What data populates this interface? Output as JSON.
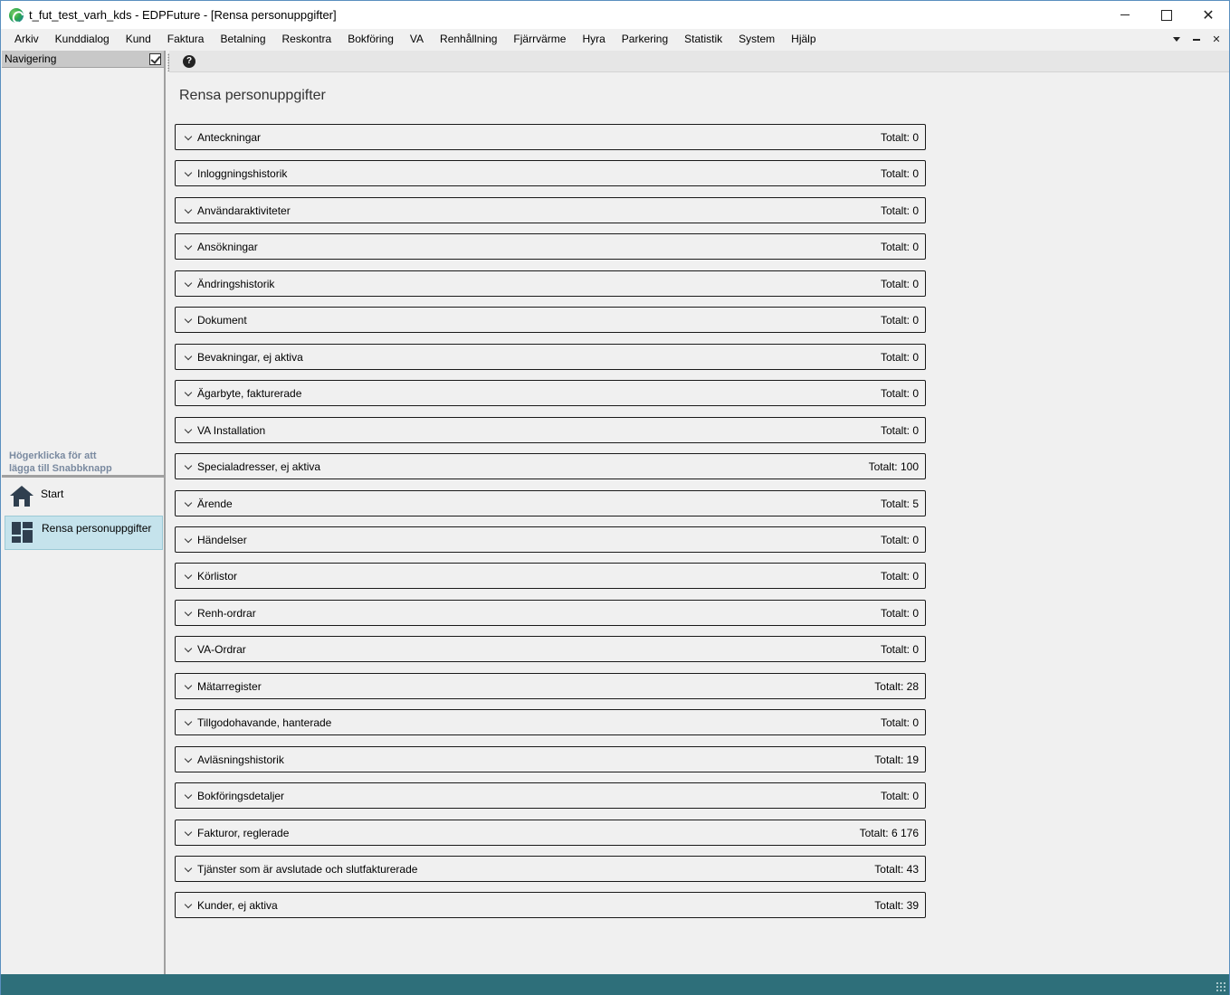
{
  "window": {
    "title": "t_fut_test_varh_kds - EDPFuture - [Rensa personuppgifter]",
    "close_glyph": "✕"
  },
  "menu": [
    "Arkiv",
    "Kunddialog",
    "Kund",
    "Faktura",
    "Betalning",
    "Reskontra",
    "Bokföring",
    "VA",
    "Renhållning",
    "Fjärrvärme",
    "Hyra",
    "Parkering",
    "Statistik",
    "System",
    "Hjälp"
  ],
  "menu_close_glyph": "✕",
  "navigation": {
    "title": "Navigering",
    "hint_line1": "Högerklicka för att",
    "hint_line2": "lägga till Snabbknapp",
    "shortcuts": [
      {
        "label": "Start",
        "icon": "home-icon",
        "active": false
      },
      {
        "label": "Rensa personuppgifter",
        "icon": "dashboard-icon",
        "active": true
      }
    ]
  },
  "toolbar": {
    "help_glyph": "?"
  },
  "page": {
    "title": "Rensa personuppgifter",
    "sections": [
      {
        "label": "Anteckningar",
        "total": "Totalt: 0"
      },
      {
        "label": "Inloggningshistorik",
        "total": "Totalt: 0"
      },
      {
        "label": "Användaraktiviteter",
        "total": "Totalt: 0"
      },
      {
        "label": "Ansökningar",
        "total": "Totalt: 0"
      },
      {
        "label": "Ändringshistorik",
        "total": "Totalt: 0"
      },
      {
        "label": "Dokument",
        "total": "Totalt: 0"
      },
      {
        "label": "Bevakningar, ej aktiva",
        "total": "Totalt: 0"
      },
      {
        "label": "Ägarbyte, fakturerade",
        "total": "Totalt: 0"
      },
      {
        "label": "VA Installation",
        "total": "Totalt: 0"
      },
      {
        "label": "Specialadresser, ej aktiva",
        "total": "Totalt: 100"
      },
      {
        "label": "Ärende",
        "total": "Totalt: 5"
      },
      {
        "label": "Händelser",
        "total": "Totalt: 0"
      },
      {
        "label": "Körlistor",
        "total": "Totalt: 0"
      },
      {
        "label": "Renh-ordrar",
        "total": "Totalt: 0"
      },
      {
        "label": "VA-Ordrar",
        "total": "Totalt: 0"
      },
      {
        "label": "Mätarregister",
        "total": "Totalt: 28"
      },
      {
        "label": "Tillgodohavande, hanterade",
        "total": "Totalt: 0"
      },
      {
        "label": "Avläsningshistorik",
        "total": "Totalt: 19"
      },
      {
        "label": "Bokföringsdetaljer",
        "total": "Totalt: 0"
      },
      {
        "label": "Fakturor, reglerade",
        "total": "Totalt: 6 176"
      },
      {
        "label": "Tjänster som är avslutade och slutfakturerade",
        "total": "Totalt: 43"
      },
      {
        "label": "Kunder, ej aktiva",
        "total": "Totalt: 39"
      }
    ]
  },
  "colors": {
    "statusbar": "#2e6f7a",
    "active_shortcut": "#c5e3ec",
    "nav_header": "#c8c8c8"
  }
}
